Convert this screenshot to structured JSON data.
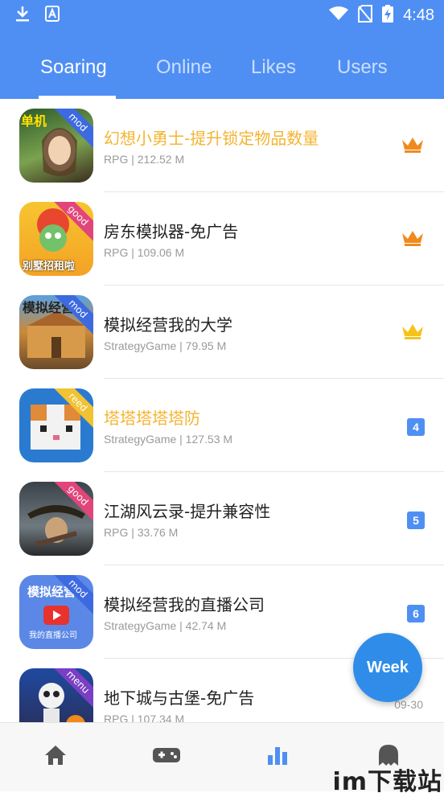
{
  "status_bar": {
    "time": "4:48"
  },
  "tabs": [
    {
      "label": "Soaring"
    },
    {
      "label": "Online"
    },
    {
      "label": "Likes"
    },
    {
      "label": "Users"
    }
  ],
  "items": [
    {
      "title": "幻想小勇士-提升锁定物品数量",
      "meta": "RPG | 212.52 M",
      "badge": "mod",
      "badge_color": "#3d6ae0",
      "icon_text": "单机",
      "rank": "1",
      "title_color": "#f4b431"
    },
    {
      "title": "房东模拟器-免广告",
      "meta": "RPG | 109.06 M",
      "badge": "good",
      "badge_color": "#e2457a",
      "icon_text": "别墅招租啦",
      "rank": "2",
      "title_color": "#222222"
    },
    {
      "title": "模拟经营我的大学",
      "meta": "StrategyGame | 79.95 M",
      "badge": "mod",
      "badge_color": "#3d6ae0",
      "icon_text": "模拟经营",
      "rank": "3",
      "title_color": "#222222"
    },
    {
      "title": "塔塔塔塔塔防",
      "meta": "StrategyGame | 127.53 M",
      "badge": "reed",
      "badge_color": "#f1c232",
      "icon_text": "",
      "rank": "4",
      "title_color": "#f4b431"
    },
    {
      "title": "江湖风云录-提升兼容性",
      "meta": "RPG | 33.76 M",
      "badge": "good",
      "badge_color": "#e2457a",
      "icon_text": "",
      "rank": "5",
      "title_color": "#222222"
    },
    {
      "title": "模拟经营我的直播公司",
      "meta": "StrategyGame | 42.74 M",
      "badge": "mod",
      "badge_color": "#3d6ae0",
      "icon_text": "模拟经营",
      "icon_subtext": "我的直播公司",
      "rank": "6",
      "title_color": "#222222"
    },
    {
      "title": "地下城与古堡-免广告",
      "meta": "RPG | 107.34 M",
      "badge": "menu",
      "badge_color": "#7a3fc4",
      "icon_text": "",
      "date": "09-30",
      "title_color": "#222222"
    }
  ],
  "fab": {
    "label": "Week"
  },
  "watermark": "im下载站",
  "colors": {
    "accent": "#4f8ff3",
    "gold": "#f4b431",
    "crown_orange": "#f08a1d",
    "crown_yellow": "#f6c21a"
  }
}
